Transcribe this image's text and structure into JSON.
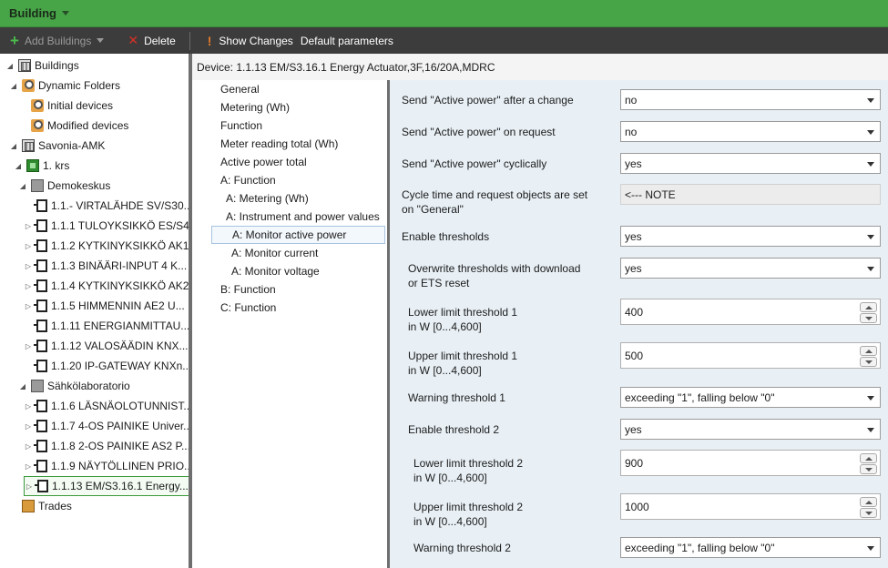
{
  "titlebar": {
    "title": "Building"
  },
  "toolbar": {
    "add_buildings": "Add Buildings",
    "delete": "Delete",
    "show_changes": "Show Changes",
    "default_parameters": "Default parameters"
  },
  "tree": [
    {
      "label": "Buildings",
      "icon": "building-icon"
    },
    {
      "label": "Dynamic Folders",
      "icon": "folder-icon"
    },
    {
      "label": "Initial devices",
      "icon": "folder-icon"
    },
    {
      "label": "Modified devices",
      "icon": "folder-icon"
    },
    {
      "label": "Savonia-AMK",
      "icon": "building-icon"
    },
    {
      "label": "1. krs",
      "icon": "floor-icon"
    },
    {
      "label": "Demokeskus",
      "icon": "room-icon"
    },
    {
      "label": "1.1.- VIRTALÄHDE SV/S30...",
      "icon": "device-icon"
    },
    {
      "label": "1.1.1 TULOYKSIKKÖ ES/S4...",
      "icon": "device-icon"
    },
    {
      "label": "1.1.2 KYTKINYKSIKKÖ AK1...",
      "icon": "device-icon"
    },
    {
      "label": "1.1.3 BINÄÄRI-INPUT 4 K...",
      "icon": "device-icon"
    },
    {
      "label": "1.1.4 KYTKINYKSIKKÖ AK2...",
      "icon": "device-icon"
    },
    {
      "label": "1.1.5 HIMMENNIN AE2 U...",
      "icon": "device-icon"
    },
    {
      "label": "1.1.11 ENERGIANMITTAU...",
      "icon": "device-icon"
    },
    {
      "label": "1.1.12 VALOSÄÄDIN KNX...",
      "icon": "device-icon"
    },
    {
      "label": "1.1.20 IP-GATEWAY KNXn...",
      "icon": "device-icon"
    },
    {
      "label": "Sähkölaboratorio",
      "icon": "room-icon"
    },
    {
      "label": "1.1.6 LÄSNÄOLOTUNNIST...",
      "icon": "device-icon"
    },
    {
      "label": "1.1.7 4-OS PAINIKE Univer...",
      "icon": "device-icon"
    },
    {
      "label": "1.1.8 2-OS PAINIKE AS2 P...",
      "icon": "device-icon"
    },
    {
      "label": "1.1.9 NÄYTÖLLINEN PRIO...",
      "icon": "device-icon"
    },
    {
      "label": "1.1.13  EM/S3.16.1 Energy...",
      "icon": "device-icon"
    },
    {
      "label": "Trades",
      "icon": "trades-icon"
    }
  ],
  "device_header": "Device: 1.1.13  EM/S3.16.1 Energy Actuator,3F,16/20A,MDRC",
  "nav": [
    "General",
    "Metering (Wh)",
    "Function",
    "Meter reading total (Wh)",
    "Active power total",
    "A: Function",
    "A: Metering (Wh)",
    "A: Instrument and power values",
    "A: Monitor active power",
    "A: Monitor current",
    "A: Monitor voltage",
    "B: Function",
    "C: Function"
  ],
  "params": {
    "send_after_change": {
      "label": "Send \"Active power\" after a change",
      "value": "no"
    },
    "send_on_request": {
      "label": "Send \"Active power\" on request",
      "value": "no"
    },
    "send_cyclically": {
      "label": "Send \"Active power\" cyclically",
      "value": "yes"
    },
    "cycle_note": {
      "label1": "Cycle time and request objects are set",
      "label2": "on \"General\"",
      "value": "<--- NOTE"
    },
    "enable_thresholds": {
      "label": "Enable thresholds",
      "value": "yes"
    },
    "overwrite": {
      "label1": "Overwrite thresholds with download",
      "label2": "or ETS reset",
      "value": "yes"
    },
    "lower_1": {
      "label1": "Lower limit threshold 1",
      "label2": "in W [0...4,600]",
      "value": "400"
    },
    "upper_1": {
      "label1": "Upper limit threshold 1",
      "label2": "in W [0...4,600]",
      "value": "500"
    },
    "warning_1": {
      "label": "Warning threshold 1",
      "value": "exceeding \"1\", falling below \"0\""
    },
    "enable_2": {
      "label": "Enable threshold 2",
      "value": "yes"
    },
    "lower_2": {
      "label1": "Lower limit threshold 2",
      "label2": "in W [0...4,600]",
      "value": "900"
    },
    "upper_2": {
      "label1": "Upper limit threshold 2",
      "label2": "in W [0...4,600]",
      "value": "1000"
    },
    "warning_2": {
      "label": "Warning threshold 2",
      "value": "exceeding \"1\", falling below \"0\""
    }
  }
}
